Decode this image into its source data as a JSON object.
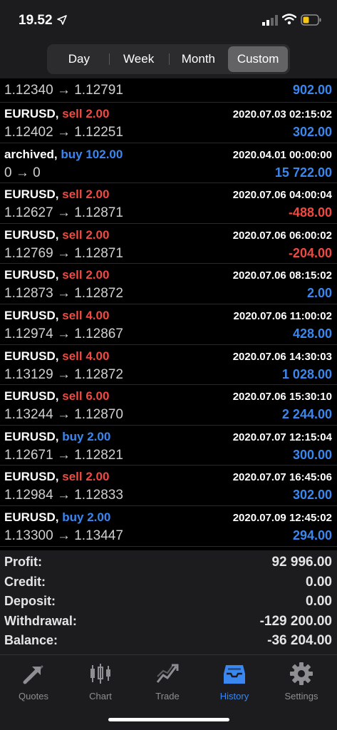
{
  "status_bar": {
    "time": "19.52",
    "icons": [
      "location-arrow-icon",
      "signal-icon",
      "wifi-icon",
      "battery-icon"
    ],
    "battery_color": "#f5c518"
  },
  "period_tabs": [
    {
      "label": "Day",
      "active": false
    },
    {
      "label": "Week",
      "active": false
    },
    {
      "label": "Month",
      "active": false
    },
    {
      "label": "Custom",
      "active": true
    }
  ],
  "first_row": {
    "prices": "1.12340 → 1.12791",
    "amount": "902.00"
  },
  "deals": [
    {
      "symbol": "EURUSD,",
      "type": "sell",
      "volume": "sell 2.00",
      "date": "2020.07.03 02:15:02",
      "prices": "1.12402 → 1.12251",
      "amount": "302.00",
      "positive": true
    },
    {
      "symbol": "archived,",
      "type": "buy",
      "volume": "buy 102.00",
      "date": "2020.04.01 00:00:00",
      "prices": "0 → 0",
      "amount": "15 722.00",
      "positive": true
    },
    {
      "symbol": "EURUSD,",
      "type": "sell",
      "volume": "sell 2.00",
      "date": "2020.07.06 04:00:04",
      "prices": "1.12627 → 1.12871",
      "amount": "-488.00",
      "positive": false
    },
    {
      "symbol": "EURUSD,",
      "type": "sell",
      "volume": "sell 2.00",
      "date": "2020.07.06 06:00:02",
      "prices": "1.12769 → 1.12871",
      "amount": "-204.00",
      "positive": false
    },
    {
      "symbol": "EURUSD,",
      "type": "sell",
      "volume": "sell 2.00",
      "date": "2020.07.06 08:15:02",
      "prices": "1.12873 → 1.12872",
      "amount": "2.00",
      "positive": true
    },
    {
      "symbol": "EURUSD,",
      "type": "sell",
      "volume": "sell 4.00",
      "date": "2020.07.06 11:00:02",
      "prices": "1.12974 → 1.12867",
      "amount": "428.00",
      "positive": true
    },
    {
      "symbol": "EURUSD,",
      "type": "sell",
      "volume": "sell 4.00",
      "date": "2020.07.06 14:30:03",
      "prices": "1.13129 → 1.12872",
      "amount": "1 028.00",
      "positive": true
    },
    {
      "symbol": "EURUSD,",
      "type": "sell",
      "volume": "sell 6.00",
      "date": "2020.07.06 15:30:10",
      "prices": "1.13244 → 1.12870",
      "amount": "2 244.00",
      "positive": true
    },
    {
      "symbol": "EURUSD,",
      "type": "buy",
      "volume": "buy 2.00",
      "date": "2020.07.07 12:15:04",
      "prices": "1.12671 → 1.12821",
      "amount": "300.00",
      "positive": true
    },
    {
      "symbol": "EURUSD,",
      "type": "sell",
      "volume": "sell 2.00",
      "date": "2020.07.07 16:45:06",
      "prices": "1.12984 → 1.12833",
      "amount": "302.00",
      "positive": true
    },
    {
      "symbol": "EURUSD,",
      "type": "buy",
      "volume": "buy 2.00",
      "date": "2020.07.09 12:45:02",
      "prices": "1.13300 → 1.13447",
      "amount": "294.00",
      "positive": true
    }
  ],
  "summary": [
    {
      "label": "Profit:",
      "value": "92 996.00"
    },
    {
      "label": "Credit:",
      "value": "0.00"
    },
    {
      "label": "Deposit:",
      "value": "0.00"
    },
    {
      "label": "Withdrawal:",
      "value": "-129 200.00"
    },
    {
      "label": "Balance:",
      "value": "-36 204.00"
    }
  ],
  "tabbar": [
    {
      "label": "Quotes",
      "icon": "quotes-arrows-icon",
      "active": false
    },
    {
      "label": "Chart",
      "icon": "candlestick-chart-icon",
      "active": false
    },
    {
      "label": "Trade",
      "icon": "trade-line-icon",
      "active": false
    },
    {
      "label": "History",
      "icon": "history-inbox-icon",
      "active": true
    },
    {
      "label": "Settings",
      "icon": "gear-icon",
      "active": false
    }
  ],
  "colors": {
    "sell": "#ef4a42",
    "buy": "#3a87f0",
    "profit_positive": "#3a87f0",
    "profit_negative": "#ef4a42",
    "tab_active": "#3a87f0",
    "tab_inactive": "#8e8e93"
  }
}
